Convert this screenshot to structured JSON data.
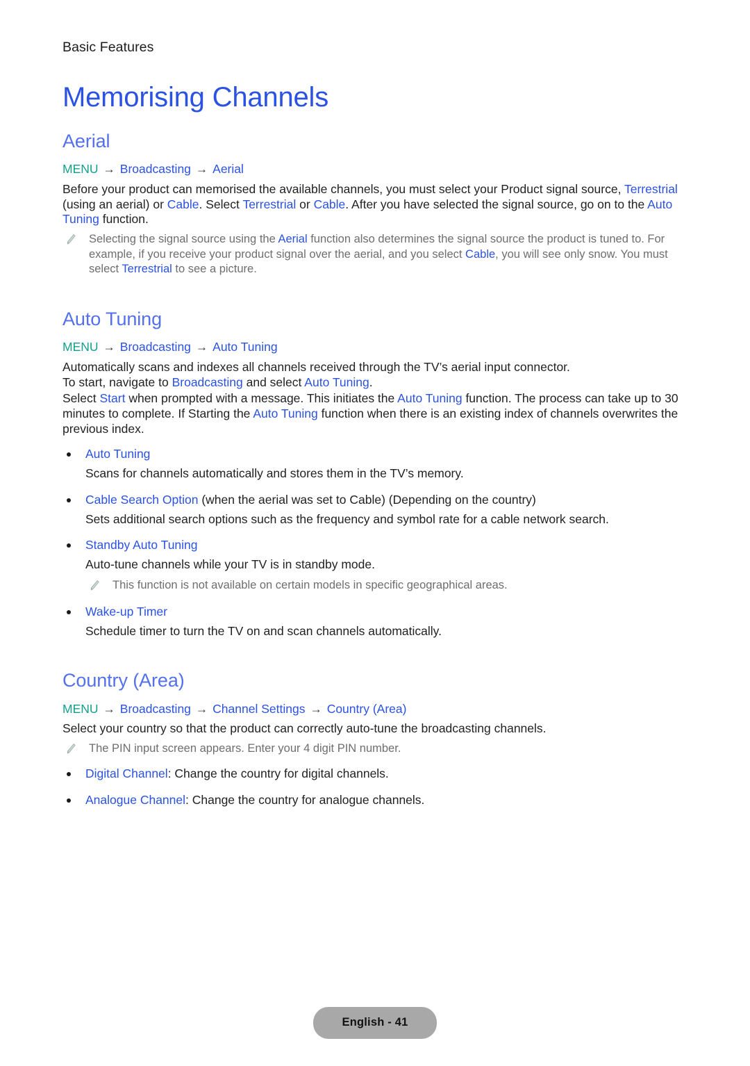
{
  "header": {
    "running_title": "Basic Features"
  },
  "doc": {
    "title": "Memorising Channels"
  },
  "sections": {
    "aerial": {
      "heading": "Aerial",
      "breadcrumb": {
        "menu": "MENU",
        "arrow": "→",
        "items": [
          "Broadcasting",
          "Aerial"
        ]
      },
      "paragraph_parts": [
        {
          "t": "Before your product can memorised the available channels, you must select your Product signal source, ",
          "hl": false
        },
        {
          "t": "Terrestrial",
          "hl": true
        },
        {
          "t": " (using an aerial) or ",
          "hl": false
        },
        {
          "t": "Cable",
          "hl": true
        },
        {
          "t": ". Select ",
          "hl": false
        },
        {
          "t": "Terrestrial",
          "hl": true
        },
        {
          "t": " or ",
          "hl": false
        },
        {
          "t": "Cable",
          "hl": true
        },
        {
          "t": ". After you have selected the signal source, go on to the ",
          "hl": false
        },
        {
          "t": "Auto Tuning",
          "hl": true
        },
        {
          "t": " function.",
          "hl": false
        }
      ],
      "note_parts": [
        {
          "t": "Selecting the signal source using the ",
          "hl": false
        },
        {
          "t": "Aerial",
          "hl": true
        },
        {
          "t": " function also determines the signal source the product is tuned to. For example, if you receive your product signal over the aerial, and you select ",
          "hl": false
        },
        {
          "t": "Cable",
          "hl": true
        },
        {
          "t": ", you will see only snow. You must select ",
          "hl": false
        },
        {
          "t": "Terrestrial",
          "hl": true
        },
        {
          "t": " to see a picture.",
          "hl": false
        }
      ]
    },
    "auto_tuning": {
      "heading": "Auto Tuning",
      "breadcrumb": {
        "menu": "MENU",
        "arrow": "→",
        "items": [
          "Broadcasting",
          "Auto Tuning"
        ]
      },
      "paragraph1_parts": [
        {
          "t": "Automatically scans and indexes all channels received through the TV’s aerial input connector.",
          "hl": false
        }
      ],
      "paragraph2_parts": [
        {
          "t": "To start, navigate to ",
          "hl": false
        },
        {
          "t": "Broadcasting",
          "hl": true
        },
        {
          "t": " and select ",
          "hl": false
        },
        {
          "t": "Auto Tuning",
          "hl": true
        },
        {
          "t": ".",
          "hl": false
        }
      ],
      "paragraph3_parts": [
        {
          "t": "Select ",
          "hl": false
        },
        {
          "t": "Start",
          "hl": true
        },
        {
          "t": " when prompted with a message. This initiates the ",
          "hl": false
        },
        {
          "t": "Auto Tuning",
          "hl": true
        },
        {
          "t": " function. The process can take up to 30 minutes to complete. If Starting the ",
          "hl": false
        },
        {
          "t": "Auto Tuning",
          "hl": true
        },
        {
          "t": " function when there is an existing index of channels overwrites the previous index.",
          "hl": false
        }
      ],
      "bullets": [
        {
          "term": "Auto Tuning",
          "term_suffix": "",
          "desc": "Scans for channels automatically and stores them in the TV’s memory.",
          "note": null
        },
        {
          "term": "Cable Search Option",
          "term_suffix": " (when the aerial was set to Cable) (Depending on the country)",
          "desc": "Sets additional search options such as the frequency and symbol rate for a cable network search.",
          "note": null
        },
        {
          "term": "Standby Auto Tuning",
          "term_suffix": "",
          "desc": "Auto-tune channels while your TV is in standby mode.",
          "note": "This function is not available on certain models in specific geographical areas."
        },
        {
          "term": "Wake-up Timer",
          "term_suffix": "",
          "desc": "Schedule timer to turn the TV on and scan channels automatically.",
          "note": null
        }
      ]
    },
    "country_area": {
      "heading": "Country (Area)",
      "breadcrumb": {
        "menu": "MENU",
        "arrow": "→",
        "items": [
          "Broadcasting",
          "Channel Settings",
          "Country (Area)"
        ]
      },
      "paragraph_parts": [
        {
          "t": "Select your country so that the product can correctly auto-tune the broadcasting channels.",
          "hl": false
        }
      ],
      "note_parts": [
        {
          "t": "The PIN input screen appears. Enter your 4 digit PIN number.",
          "hl": false
        }
      ],
      "bullets": [
        {
          "term": "Digital Channel",
          "term_suffix": ": Change the country for digital channels.",
          "desc": null,
          "note": null
        },
        {
          "term": "Analogue Channel",
          "term_suffix": ": Change the country for analogue channels.",
          "desc": null,
          "note": null
        }
      ]
    }
  },
  "footer": {
    "page_label": "English - 41"
  },
  "colors": {
    "title_blue": "#2b52e0",
    "heading_blue": "#5470ea",
    "link_blue": "#2b52e0",
    "menu_teal": "#13a08e",
    "note_gray": "#6e6e6e",
    "body": "#222222",
    "pill_bg": "#a8a8a8"
  }
}
